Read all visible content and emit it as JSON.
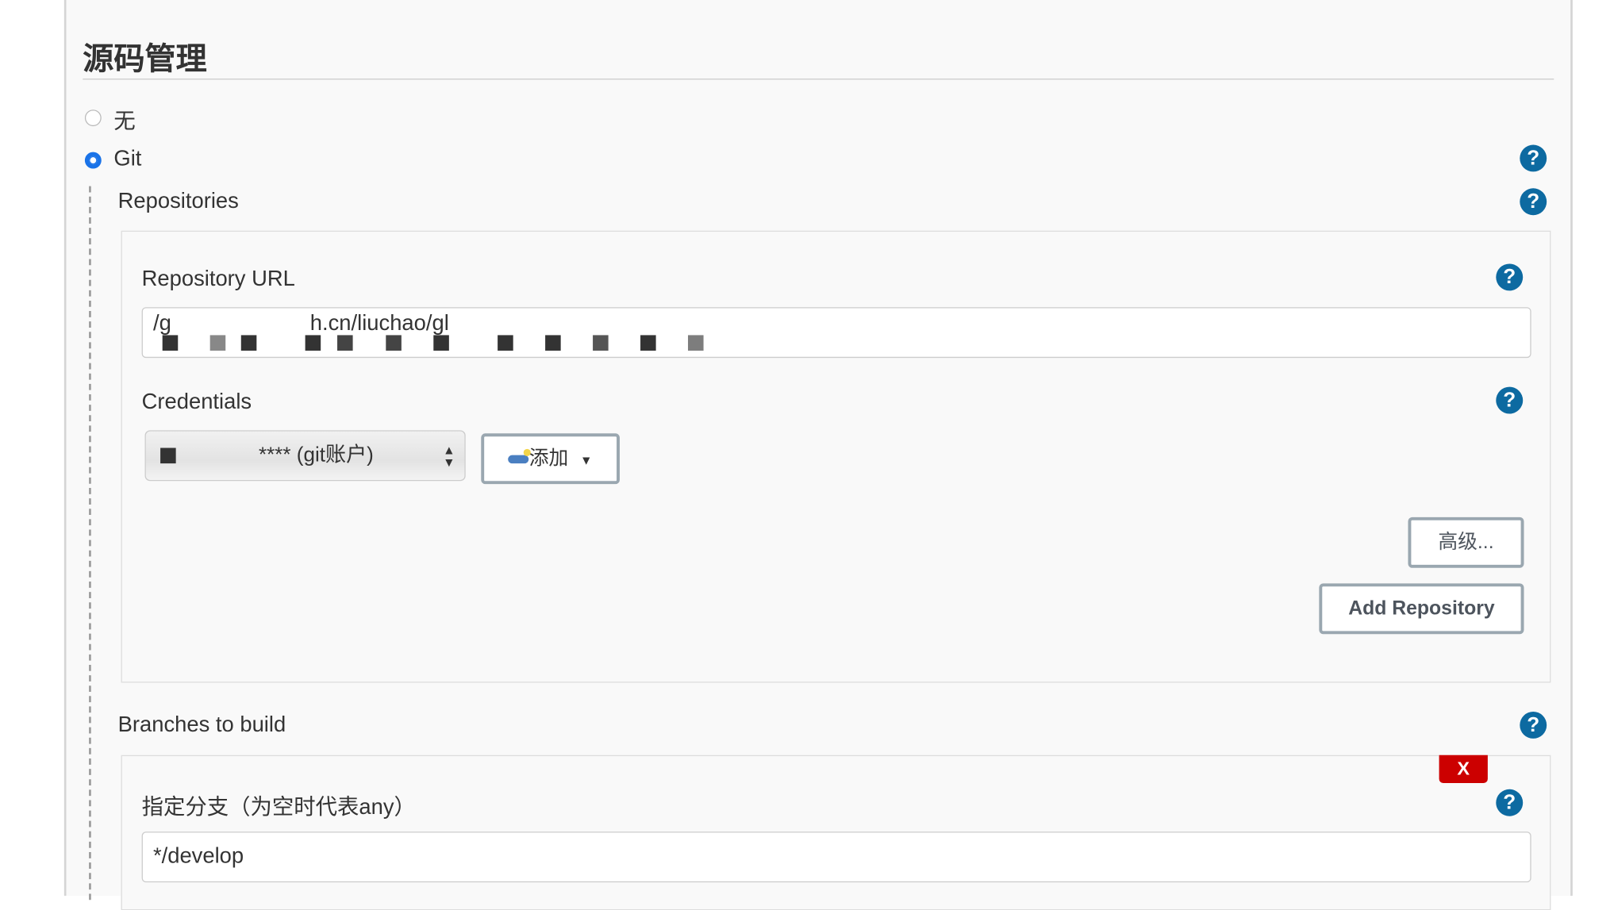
{
  "section": {
    "title": "源码管理"
  },
  "scm_options": [
    {
      "label": "无",
      "selected": false
    },
    {
      "label": "Git",
      "selected": true
    }
  ],
  "repositories": {
    "label": "Repositories",
    "url_label": "Repository URL",
    "url_value": "/g                       h.cn/liuchao/gl",
    "credentials_label": "Credentials",
    "credentials_value": "****  (git账户)",
    "add_label": "添加",
    "advanced_label": "高级...",
    "add_repository_label": "Add Repository"
  },
  "branches": {
    "label": "Branches to build",
    "remove_label": "X",
    "branch_label": "指定分支（为空时代表any）",
    "branch_value": "*/develop"
  },
  "help_glyph": "?",
  "icons": {
    "help": "help-circle-icon",
    "key": "key-icon",
    "caret": "caret-down-icon",
    "select_arrows": "updown-arrows-icon"
  },
  "colors": {
    "help": "#0d6aa1",
    "radio_selected": "#1a73e8",
    "remove": "#cc0000"
  }
}
